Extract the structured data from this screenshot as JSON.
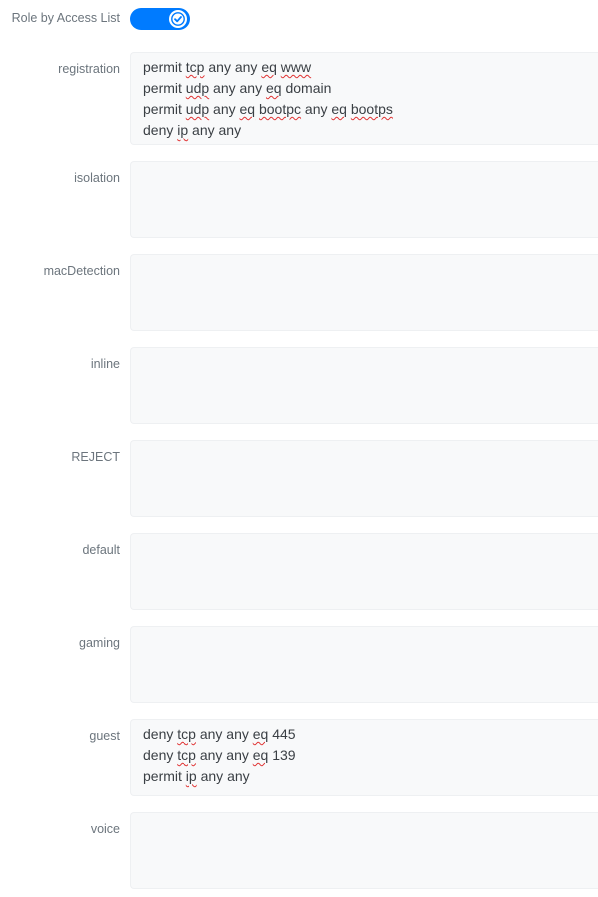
{
  "toggle": {
    "label": "Role by Access List",
    "enabled": true,
    "accent_color": "#007bff",
    "knob_icon": "check-icon"
  },
  "misspelled_words": [
    "tcp",
    "udp",
    "eq",
    "www",
    "bootpc",
    "bootps",
    "ip"
  ],
  "roles": [
    {
      "name": "registration",
      "acl": [
        "permit tcp any any eq www",
        "permit udp any any eq domain",
        "permit udp any eq bootpc any eq bootps",
        "deny ip any any"
      ]
    },
    {
      "name": "isolation",
      "acl": []
    },
    {
      "name": "macDetection",
      "acl": []
    },
    {
      "name": "inline",
      "acl": []
    },
    {
      "name": "REJECT",
      "acl": []
    },
    {
      "name": "default",
      "acl": []
    },
    {
      "name": "gaming",
      "acl": []
    },
    {
      "name": "guest",
      "acl": [
        "deny tcp any any eq 445",
        "deny tcp any any eq 139",
        "permit ip any any"
      ]
    },
    {
      "name": "voice",
      "acl": []
    }
  ]
}
